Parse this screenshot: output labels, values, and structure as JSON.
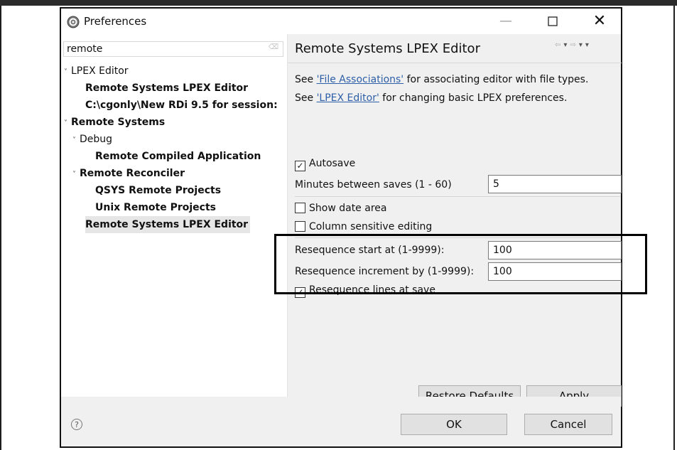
{
  "window": {
    "title": "Preferences",
    "controls": {
      "minimize": "—",
      "maximize": "☐",
      "close": "✕"
    }
  },
  "filter": {
    "value": "remote",
    "clear_icon": "clear-icon"
  },
  "tree": [
    {
      "label": "LPEX Editor",
      "expanded": true,
      "bold": false
    },
    {
      "label": "Remote Systems LPEX Editor",
      "bold": true
    },
    {
      "label": "C:\\cgonly\\New RDi 9.5 for session:",
      "bold": true
    },
    {
      "label": "Remote Systems",
      "expanded": true,
      "bold": true
    },
    {
      "label": "Debug",
      "expanded": true,
      "bold": false
    },
    {
      "label": "Remote Compiled Application",
      "bold": true
    },
    {
      "label": "Remote Reconciler",
      "expanded": true,
      "bold": true
    },
    {
      "label": "QSYS Remote Projects",
      "bold": true
    },
    {
      "label": "Unix Remote Projects",
      "bold": true
    },
    {
      "label": "Remote Systems LPEX Editor",
      "bold": true,
      "selected": true
    }
  ],
  "page": {
    "title": "Remote Systems LPEX Editor",
    "desc1": {
      "prefix": "See ",
      "link": "'File Associations'",
      "suffix": " for associating editor with file types."
    },
    "desc2": {
      "prefix": "See ",
      "link": "'LPEX Editor'",
      "suffix": " for changing basic LPEX preferences."
    },
    "autosave": {
      "label": "Autosave",
      "checked": true
    },
    "minutes": {
      "label": "Minutes between saves (1 - 60)",
      "value": "5"
    },
    "show_date_area": {
      "label": "Show date area",
      "checked": false
    },
    "column_sensitive": {
      "label": "Column sensitive editing",
      "checked": false
    },
    "reseq_start": {
      "label": "Resequence start at (1-9999):",
      "value": "100"
    },
    "reseq_increment": {
      "label": "Resequence increment by (1-9999):",
      "value": "100"
    },
    "reseq_at_save": {
      "label": "Resequence lines at save",
      "checked": true
    },
    "restore_defaults": "Restore Defaults",
    "apply": "Apply"
  },
  "buttons": {
    "ok": "OK",
    "cancel": "Cancel"
  },
  "help_symbol": "?"
}
